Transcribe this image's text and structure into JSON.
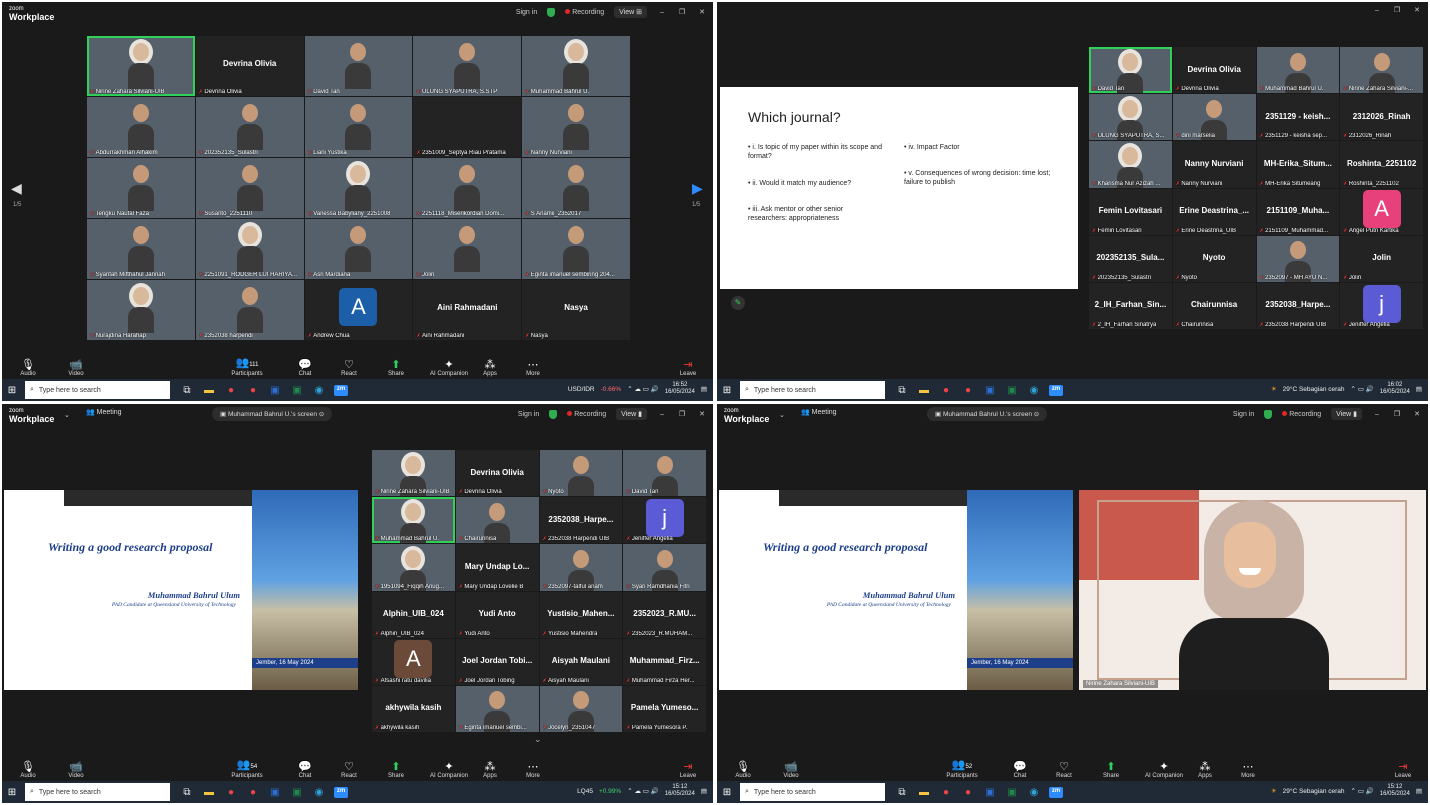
{
  "app": {
    "logo_small": "zoom",
    "logo_big": "Workplace"
  },
  "common": {
    "sign_in": "Sign in",
    "recording": "Recording",
    "view": "View",
    "meeting": "Meeting",
    "share_banner": "Muhammad Bahrul U.'s screen",
    "toolbar": {
      "audio": "Audio",
      "video": "Video",
      "participants": "Participants",
      "chat": "Chat",
      "react": "React",
      "share": "Share",
      "ai": "AI Companion",
      "apps": "Apps",
      "more": "More",
      "leave": "Leave"
    },
    "search_placeholder": "Type here to search"
  },
  "q1": {
    "participants_count": "111",
    "page_left": "1/5",
    "page_right": "1/5",
    "tiles": [
      {
        "name": "Nirine Zahara Silviani-UIB",
        "big": "",
        "video": true,
        "active": true
      },
      {
        "name": "Devrina Olivia",
        "big": "Devrina Olivia",
        "video": false
      },
      {
        "name": "David Tan",
        "big": "",
        "video": true
      },
      {
        "name": "ULUNG SYAPUTRA, S.STP",
        "big": "",
        "video": true
      },
      {
        "name": "Muhammad Bahrul U.",
        "big": "",
        "video": true
      },
      {
        "name": "Abdurrakhman Alhakim",
        "big": "",
        "video": true
      },
      {
        "name": "202352135_Sulastri",
        "big": "",
        "video": true
      },
      {
        "name": "Liani Yustika",
        "big": "",
        "video": true
      },
      {
        "name": "2351009_Septya Riau Pratama",
        "big": "",
        "video": false
      },
      {
        "name": "Nanny Nurviani",
        "big": "",
        "video": true
      },
      {
        "name": "Tengku Naufal Faza",
        "big": "",
        "video": true
      },
      {
        "name": "Susanto_2251110",
        "big": "",
        "video": true
      },
      {
        "name": "Vanessa Babyliany_2251008",
        "big": "",
        "video": true
      },
      {
        "name": "2251118_Miserikordian Domi...",
        "big": "",
        "video": true
      },
      {
        "name": "S Anamii_2352017",
        "big": "",
        "video": true
      },
      {
        "name": "Syarifah Mifthahul Jannah",
        "big": "",
        "video": true
      },
      {
        "name": "2251091_RODGER LUI HARIYA...",
        "big": "",
        "video": true
      },
      {
        "name": "Asri Mardiana",
        "big": "",
        "video": true
      },
      {
        "name": "Jolin",
        "big": "",
        "video": true
      },
      {
        "name": "Eginta imanuel sembiring 204...",
        "big": "",
        "video": true
      },
      {
        "name": "Nurajdina Harahap",
        "big": "",
        "video": true
      },
      {
        "name": "2352038 harpendi",
        "big": "",
        "video": true
      },
      {
        "name": "Andrew Chua",
        "big": "",
        "avatar": "A"
      },
      {
        "name": "Aini Rahmadani",
        "big": "Aini Rahmadani",
        "video": false
      },
      {
        "name": "Nasya",
        "big": "Nasya",
        "video": false
      }
    ],
    "tray": {
      "ticker": "USD/IDR",
      "change": "-0.66%",
      "time": "16:52",
      "date": "16/05/2024"
    }
  },
  "q2": {
    "slide": {
      "title": "Which journal?",
      "left_bullets": [
        "i. Is topic of my paper within its scope and format?",
        "ii.  Would it match my audience?",
        "iii. Ask mentor or other senior researchers: appropriateness"
      ],
      "right_bullets": [
        "iv. Impact Factor",
        "v. Consequences of wrong decision: time lost; failure to publish"
      ]
    },
    "tiles": [
      {
        "name": "David Tan",
        "big": "",
        "video": true,
        "active": true
      },
      {
        "name": "Devrina Olivia",
        "big": "Devrina Olivia",
        "video": false
      },
      {
        "name": "Muhammad Bahrul U.",
        "big": "",
        "video": true
      },
      {
        "name": "Nirine Zahara Silviani-...",
        "big": "",
        "video": true
      },
      {
        "name": "ULUNG SYAPUTRA, S...",
        "big": "",
        "video": true
      },
      {
        "name": "dini marselia",
        "big": "",
        "video": true
      },
      {
        "name": "2351129 - keisha sep...",
        "big": "2351129 - keish...",
        "video": false
      },
      {
        "name": "2312026_Rinah",
        "big": "2312026_Rinah",
        "video": false
      },
      {
        "name": "Kharisma Nur Azizah ...",
        "big": "",
        "video": true
      },
      {
        "name": "Nanny Nurviani",
        "big": "Nanny Nurviani",
        "video": false
      },
      {
        "name": "MH-Erika Situmeang",
        "big": "MH-Erika_Situm...",
        "video": false
      },
      {
        "name": "Roshinta_2251102",
        "big": "Roshinta_2251102",
        "video": false
      },
      {
        "name": "Femin Lovitasari",
        "big": "Femin Lovitasari",
        "video": false
      },
      {
        "name": "Erine Deastrina_UIB",
        "big": "Erine Deastrina_...",
        "video": false
      },
      {
        "name": "2151109_Muhammad...",
        "big": "2151109_Muha...",
        "video": false
      },
      {
        "name": "Angel Putri Kartika",
        "big": "",
        "avatar": "A",
        "avatar_color": "#e8407a"
      },
      {
        "name": "202352135_Sulastri",
        "big": "202352135_Sula...",
        "video": false
      },
      {
        "name": "Nyoto",
        "big": "Nyoto",
        "video": false
      },
      {
        "name": "2352097 - MH AYU N...",
        "big": "",
        "video": true
      },
      {
        "name": "Jolin",
        "big": "Jolin",
        "video": false
      },
      {
        "name": "2_IH_Farhan Sinatrya",
        "big": "2_IH_Farhan_Sin...",
        "video": false
      },
      {
        "name": "Chairunnisa",
        "big": "Chairunnisa",
        "video": false
      },
      {
        "name": "2352038 Harpendi UIB",
        "big": "2352038_Harpe...",
        "video": false
      },
      {
        "name": "Jeniffer Angelia",
        "big": "",
        "avatar": "j",
        "avatar_color": "#5b5bd6"
      }
    ],
    "tray": {
      "weather": "29°C  Sebagian cerah",
      "time": "16:02",
      "date": "16/05/2024"
    }
  },
  "presentation": {
    "title": "Writing a good research proposal",
    "presenter": "Muhammad Bahrul Ulum",
    "affiliation": "PhD Candidate at Queensland University of Technology",
    "date": "Jember, 16 May 2024"
  },
  "q3": {
    "participants_count": "54",
    "tiles": [
      {
        "name": "Nirine Zahara Silviani-UIB",
        "big": "",
        "video": true
      },
      {
        "name": "Devrina Olivia",
        "big": "Devrina Olivia",
        "video": false
      },
      {
        "name": "Nyoto",
        "big": "",
        "video": true
      },
      {
        "name": "David Tan",
        "big": "",
        "video": true
      },
      {
        "name": "Muhammad Bahrul U.",
        "big": "",
        "video": true,
        "active": true
      },
      {
        "name": "Chairunnisa",
        "big": "",
        "video": true
      },
      {
        "name": "2352038 Harpendi UIB",
        "big": "2352038_Harpe...",
        "video": false
      },
      {
        "name": "Jeniffer Angelia",
        "big": "",
        "avatar": "j",
        "avatar_color": "#5b5bd6"
      },
      {
        "name": "1951094_Fiqqih Anug...",
        "big": "",
        "video": true
      },
      {
        "name": "Mary Undap Lovelie B",
        "big": "Mary Undap Lo...",
        "video": false
      },
      {
        "name": "2352097-talful anam",
        "big": "",
        "video": true
      },
      {
        "name": "Syari Ramdhania Fitri",
        "big": "",
        "video": true
      },
      {
        "name": "Alphin_UIB_024",
        "big": "Alphin_UIB_024",
        "video": false
      },
      {
        "name": "Yudi Anto",
        "big": "Yudi Anto",
        "video": false
      },
      {
        "name": "Yustisio Mahendra",
        "big": "Yustisio_Mahen...",
        "video": false
      },
      {
        "name": "2352023_R.MUHAM...",
        "big": "2352023_R.MU...",
        "video": false
      },
      {
        "name": "Afsashi ratu davilia",
        "big": "",
        "avatar": "A",
        "avatar_color": "#6b4a3a"
      },
      {
        "name": "Joel Jordan Tobing",
        "big": "Joel Jordan Tobi...",
        "video": false
      },
      {
        "name": "Aisyah Maulani",
        "big": "Aisyah Maulani",
        "video": false
      },
      {
        "name": "Muhammad Firza Her...",
        "big": "Muhammad_Firz...",
        "video": false
      },
      {
        "name": "akhywila kasih",
        "big": "akhywila kasih",
        "video": false
      },
      {
        "name": "Eginta imanuel sembi...",
        "big": "",
        "video": true
      },
      {
        "name": "Jocelyn_2351047",
        "big": "",
        "video": true
      },
      {
        "name": "Pamela Yumesora P.",
        "big": "Pamela Yumeso...",
        "video": false
      }
    ],
    "tray": {
      "ticker": "LQ45",
      "change": "+0.99%",
      "time": "15:12",
      "date": "16/05/2024"
    }
  },
  "q4": {
    "participants_count": "52",
    "speaker_name": "Nirine Zahara Silviani-UIB",
    "tray": {
      "weather": "29°C  Sebagian cerah",
      "time": "15:12",
      "date": "16/05/2024"
    }
  }
}
